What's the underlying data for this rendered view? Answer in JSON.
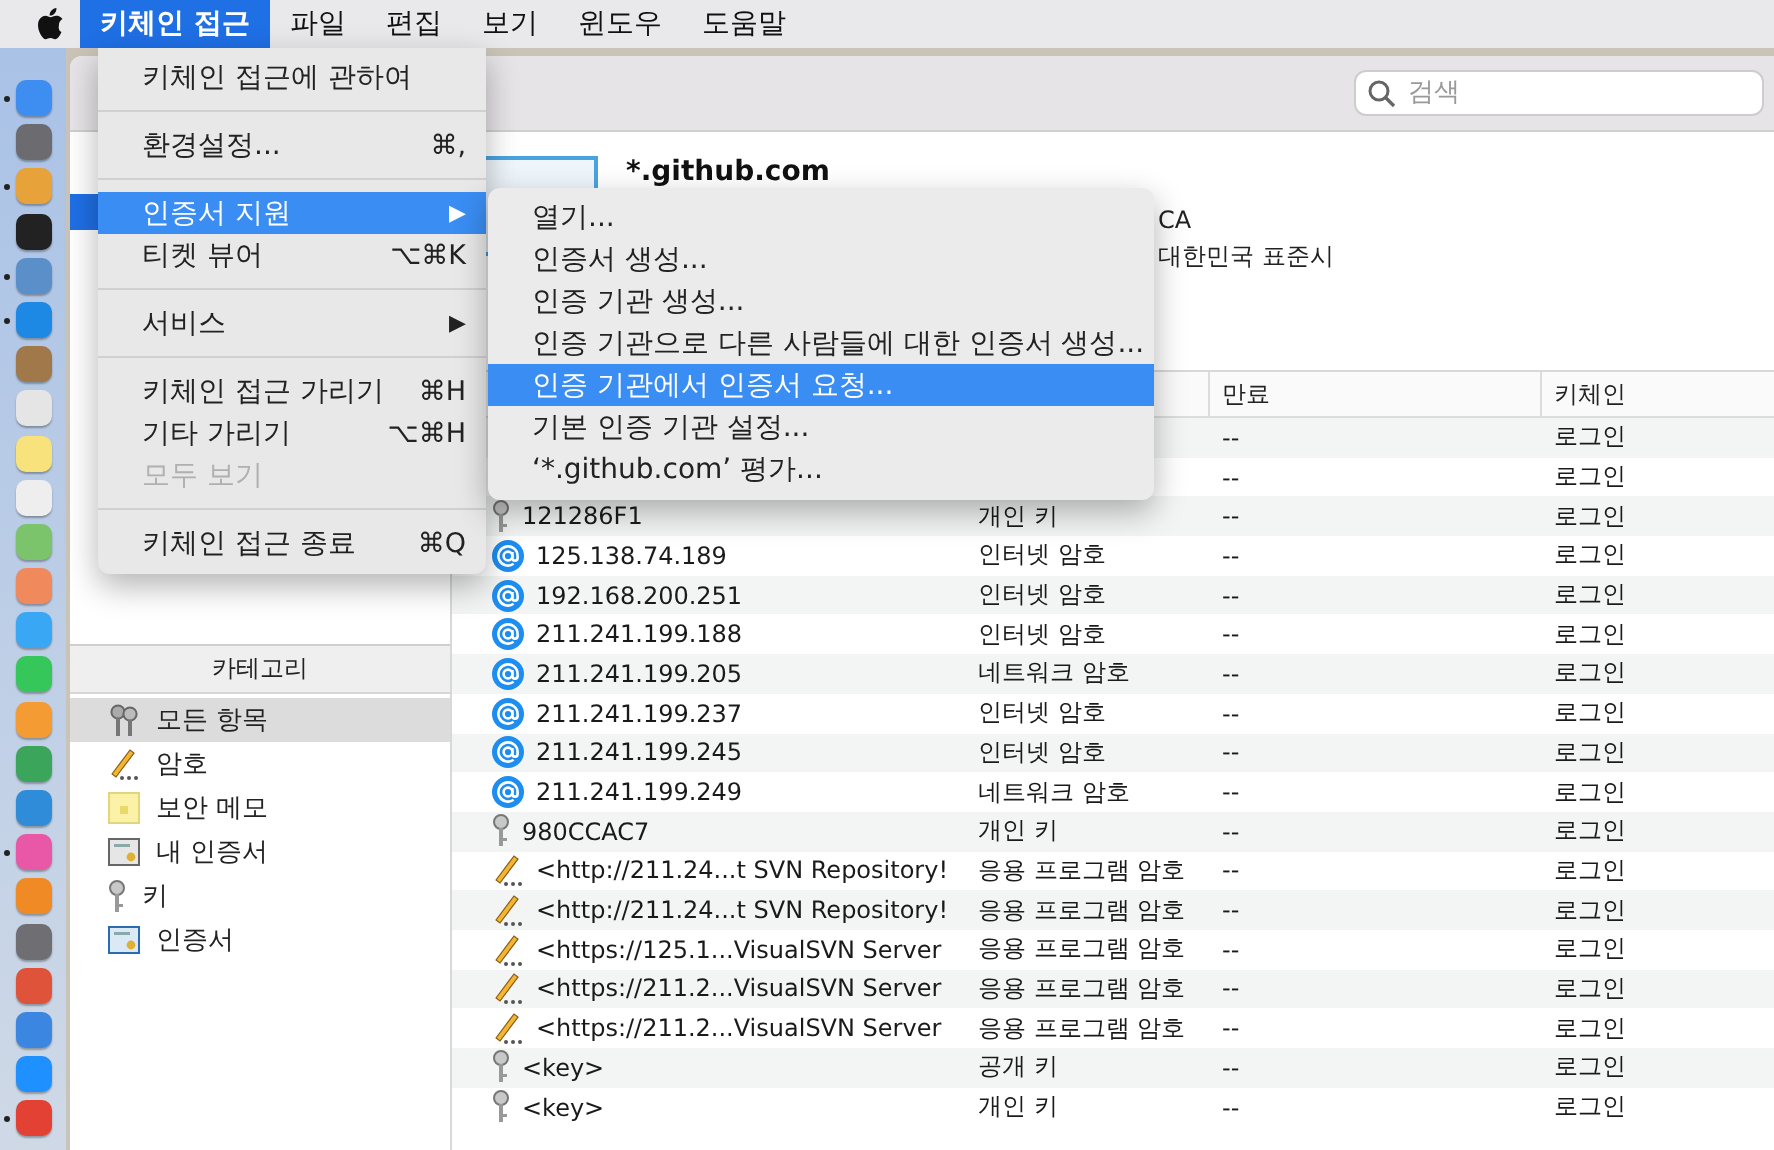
{
  "menu_bar": {
    "items": [
      {
        "label": "키체인 접근",
        "selected": true
      },
      {
        "label": "파일",
        "selected": false
      },
      {
        "label": "편집",
        "selected": false
      },
      {
        "label": "보기",
        "selected": false
      },
      {
        "label": "윈도우",
        "selected": false
      },
      {
        "label": "도움말",
        "selected": false
      }
    ]
  },
  "dock": [
    {
      "color": "#3d8ef0",
      "running": true
    },
    {
      "color": "#6c6c70",
      "running": false
    },
    {
      "color": "#e8a23a",
      "running": true
    },
    {
      "color": "#222222",
      "running": false
    },
    {
      "color": "#5a8fc9",
      "running": true
    },
    {
      "color": "#1e88e5",
      "running": true
    },
    {
      "color": "#a0784a",
      "running": false
    },
    {
      "color": "#e5e5e5",
      "running": false
    },
    {
      "color": "#f7e27c",
      "running": false
    },
    {
      "color": "#eeeeee",
      "running": false
    },
    {
      "color": "#7cc46c",
      "running": false
    },
    {
      "color": "#f08a5d",
      "running": false
    },
    {
      "color": "#3aa7f5",
      "running": false
    },
    {
      "color": "#35c759",
      "running": false
    },
    {
      "color": "#f49b34",
      "running": false
    },
    {
      "color": "#3ba55c",
      "running": false
    },
    {
      "color": "#2f8cd8",
      "running": false
    },
    {
      "color": "#e957a7",
      "running": true
    },
    {
      "color": "#f08a24",
      "running": false
    },
    {
      "color": "#6e6e73",
      "running": false
    },
    {
      "color": "#e0533b",
      "running": false
    },
    {
      "color": "#3b86e0",
      "running": false
    },
    {
      "color": "#1e90ff",
      "running": false
    },
    {
      "color": "#e34133",
      "running": true
    }
  ],
  "toolbar": {
    "search": {
      "placeholder": "검색"
    }
  },
  "certificate_summary": {
    "title": "*.github.com",
    "lines": [
      "CA",
      "대한민국 표준시"
    ]
  },
  "sidebar": {
    "category_header": "카테고리",
    "categories": [
      {
        "label": "모든 항목",
        "kind": "keys",
        "selected": true
      },
      {
        "label": "암호",
        "kind": "pencil",
        "selected": false
      },
      {
        "label": "보안 메모",
        "kind": "note",
        "selected": false
      },
      {
        "label": "내 인증서",
        "kind": "mycert",
        "selected": false
      },
      {
        "label": "키",
        "kind": "key",
        "selected": false
      },
      {
        "label": "인증서",
        "kind": "cert",
        "selected": false
      }
    ]
  },
  "table": {
    "columns": [
      {
        "label": "만료"
      },
      {
        "label": "키체인"
      }
    ],
    "rows": [
      {
        "expires": "--",
        "keychain": "로그인"
      },
      {
        "expires": "--",
        "keychain": "로그인"
      },
      {
        "kind": "key",
        "name": "121286F1",
        "type": "개인 키",
        "expires": "--",
        "keychain": "로그인"
      },
      {
        "kind": "at",
        "name": "125.138.74.189",
        "type": "인터넷 암호",
        "expires": "--",
        "keychain": "로그인"
      },
      {
        "kind": "at",
        "name": "192.168.200.251",
        "type": "인터넷 암호",
        "expires": "--",
        "keychain": "로그인"
      },
      {
        "kind": "at",
        "name": "211.241.199.188",
        "type": "인터넷 암호",
        "expires": "--",
        "keychain": "로그인"
      },
      {
        "kind": "at",
        "name": "211.241.199.205",
        "type": "네트워크 암호",
        "expires": "--",
        "keychain": "로그인"
      },
      {
        "kind": "at",
        "name": "211.241.199.237",
        "type": "인터넷 암호",
        "expires": "--",
        "keychain": "로그인"
      },
      {
        "kind": "at",
        "name": "211.241.199.245",
        "type": "인터넷 암호",
        "expires": "--",
        "keychain": "로그인"
      },
      {
        "kind": "at",
        "name": "211.241.199.249",
        "type": "네트워크 암호",
        "expires": "--",
        "keychain": "로그인"
      },
      {
        "kind": "key",
        "name": "980CCAC7",
        "type": "개인 키",
        "expires": "--",
        "keychain": "로그인"
      },
      {
        "kind": "pencil",
        "name": "<http://211.24...t SVN Repository!",
        "type": "응용 프로그램 암호",
        "expires": "--",
        "keychain": "로그인"
      },
      {
        "kind": "pencil",
        "name": "<http://211.24...t SVN Repository!",
        "type": "응용 프로그램 암호",
        "expires": "--",
        "keychain": "로그인"
      },
      {
        "kind": "pencil",
        "name": "<https://125.1...VisualSVN Server",
        "type": "응용 프로그램 암호",
        "expires": "--",
        "keychain": "로그인"
      },
      {
        "kind": "pencil",
        "name": "<https://211.2...VisualSVN Server",
        "type": "응용 프로그램 암호",
        "expires": "--",
        "keychain": "로그인"
      },
      {
        "kind": "pencil",
        "name": "<https://211.2...VisualSVN Server",
        "type": "응용 프로그램 암호",
        "expires": "--",
        "keychain": "로그인"
      },
      {
        "kind": "key",
        "name": "<key>",
        "type": "공개 키",
        "expires": "--",
        "keychain": "로그인"
      },
      {
        "kind": "key",
        "name": "<key>",
        "type": "개인 키",
        "expires": "--",
        "keychain": "로그인"
      }
    ]
  },
  "app_menu": {
    "items": [
      {
        "kind": "item",
        "label": "키체인 접근에 관하여",
        "selected": false,
        "disabled": false
      },
      {
        "kind": "separator"
      },
      {
        "kind": "item",
        "label": "환경설정...",
        "shortcut": "⌘,",
        "selected": false,
        "disabled": false
      },
      {
        "kind": "separator"
      },
      {
        "kind": "item",
        "label": "인증서 지원",
        "arrow": "▶",
        "selected": true,
        "disabled": false
      },
      {
        "kind": "item",
        "label": "티켓 뷰어",
        "shortcut": "⌥⌘K",
        "selected": false,
        "disabled": false
      },
      {
        "kind": "separator"
      },
      {
        "kind": "item",
        "label": "서비스",
        "arrow": "▶",
        "selected": false,
        "disabled": false
      },
      {
        "kind": "separator"
      },
      {
        "kind": "item",
        "label": "키체인 접근 가리기",
        "shortcut": "⌘H",
        "selected": false,
        "disabled": false
      },
      {
        "kind": "item",
        "label": "기타 가리기",
        "shortcut": "⌥⌘H",
        "selected": false,
        "disabled": false
      },
      {
        "kind": "item",
        "label": "모두 보기",
        "selected": false,
        "disabled": true
      },
      {
        "kind": "separator"
      },
      {
        "kind": "item",
        "label": "키체인 접근 종료",
        "shortcut": "⌘Q",
        "selected": false,
        "disabled": false
      }
    ]
  },
  "submenu": {
    "items": [
      {
        "label": "열기...",
        "selected": false
      },
      {
        "label": "인증서 생성...",
        "selected": false
      },
      {
        "label": "인증 기관 생성...",
        "selected": false
      },
      {
        "label": "인증 기관으로 다른 사람들에 대한 인증서 생성...",
        "selected": false
      },
      {
        "label": "인증 기관에서 인증서 요청...",
        "selected": true
      },
      {
        "label": "기본 인증 기관 설정...",
        "selected": false
      },
      {
        "label": "‘*.github.com’ 평가...",
        "selected": false
      }
    ]
  }
}
